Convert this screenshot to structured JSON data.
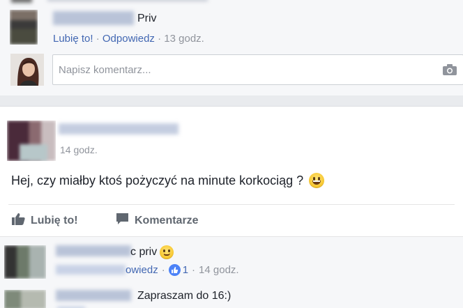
{
  "top_comment": {
    "text": "Priv",
    "like_label": "Lubię to!",
    "reply_label": "Odpowiedz",
    "separator": "·",
    "time": "13 godz."
  },
  "comment_box": {
    "placeholder": "Napisz komentarz...",
    "camera_icon": "camera-icon"
  },
  "post": {
    "time": "14 godz.",
    "text": "Hej, czy miałby ktoś pożyczyć na minute korkociąg ?",
    "emoji": "grinning-face-emoji"
  },
  "actions": {
    "like_label": "Lubię to!",
    "comment_label": "Komentarze"
  },
  "comments": [
    {
      "text_visible": "c priv",
      "reply_partial": "owiedz",
      "separator": "·",
      "like_count": "1",
      "time": "14 godz."
    },
    {
      "text": "Zapraszam do 16:)"
    }
  ],
  "colors": {
    "link": "#4267b2",
    "meta": "#90949c",
    "background": "#e9ebee",
    "like_badge": "#4c82f7"
  }
}
